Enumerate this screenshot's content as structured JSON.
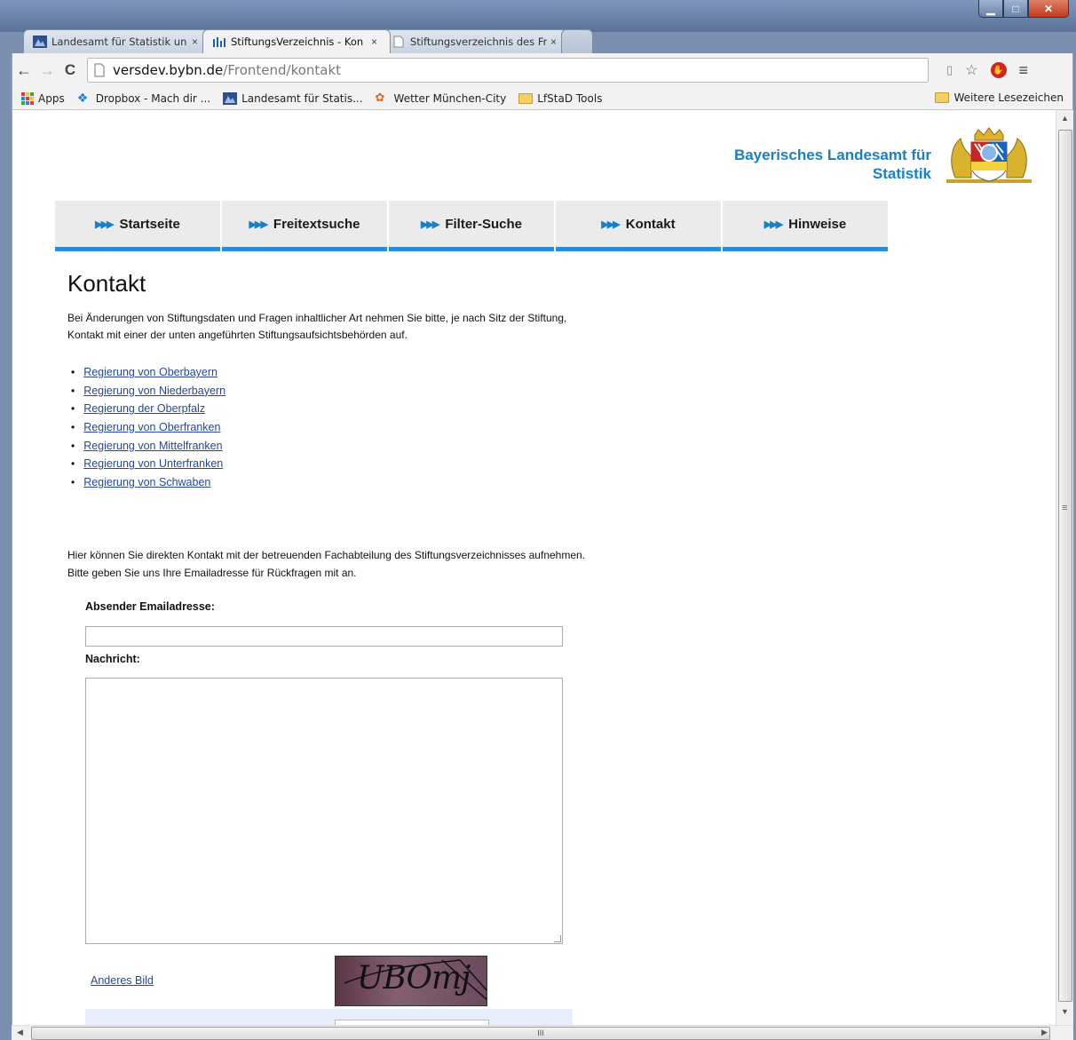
{
  "browser": {
    "tabs": [
      {
        "title": "Landesamt für Statistik un",
        "close": "×",
        "active": false
      },
      {
        "title": "StiftungsVerzeichnis - Kon",
        "close": "×",
        "active": true
      },
      {
        "title": "Stiftungsverzeichnis des Fr",
        "close": "×",
        "active": false
      }
    ],
    "url_host": "versdev.bybn.de",
    "url_path": "/Frontend/kontakt",
    "bookmarks": [
      {
        "label": "Apps",
        "icon": "apps-icon"
      },
      {
        "label": "Dropbox - Mach dir ...",
        "icon": "dropbox-icon"
      },
      {
        "label": "Landesamt für Statis...",
        "icon": "lfstat-icon"
      },
      {
        "label": "Wetter München-City",
        "icon": "weather-icon"
      },
      {
        "label": "LfStaD Tools",
        "icon": "folder-icon"
      }
    ],
    "other_bookmarks": "Weitere Lesezeichen",
    "scroll_h_label": "III",
    "scroll_v_label": "≡"
  },
  "header": {
    "org_line1": "Bayerisches Landesamt für",
    "org_line2": "Statistik"
  },
  "nav": [
    {
      "label": "Startseite"
    },
    {
      "label": "Freitextsuche"
    },
    {
      "label": "Filter-Suche"
    },
    {
      "label": "Kontakt"
    },
    {
      "label": "Hinweise"
    }
  ],
  "page": {
    "title": "Kontakt",
    "intro_line1": "Bei Änderungen von Stiftungsdaten und Fragen inhaltlicher Art nehmen Sie bitte, je nach Sitz der Stiftung,",
    "intro_line2": "Kontakt mit einer der unten angeführten Stiftungsaufsichtsbehörden auf.",
    "authorities": [
      "Regierung von Oberbayern",
      "Regierung von Niederbayern",
      "Regierung der Oberpfalz",
      "Regierung von Oberfranken",
      "Regierung von Mittelfranken",
      "Regierung von Unterfranken",
      "Regierung von Schwaben"
    ],
    "contact_line1": "Hier können Sie direkten Kontakt mit der betreuenden Fachabteilung des Stiftungsverzeichnisses aufnehmen.",
    "contact_line2": "Bitte geben Sie uns Ihre Emailadresse für Rückfragen mit an.",
    "email_label": "Absender Emailadresse:",
    "email_value": "",
    "message_label": "Nachricht:",
    "message_value": "",
    "other_image_link": "Anderes Bild",
    "captcha_text": "UBOmj"
  },
  "colors": {
    "accent": "#2b8fd6",
    "brand_text": "#1a7fc4",
    "link": "#26479c"
  }
}
